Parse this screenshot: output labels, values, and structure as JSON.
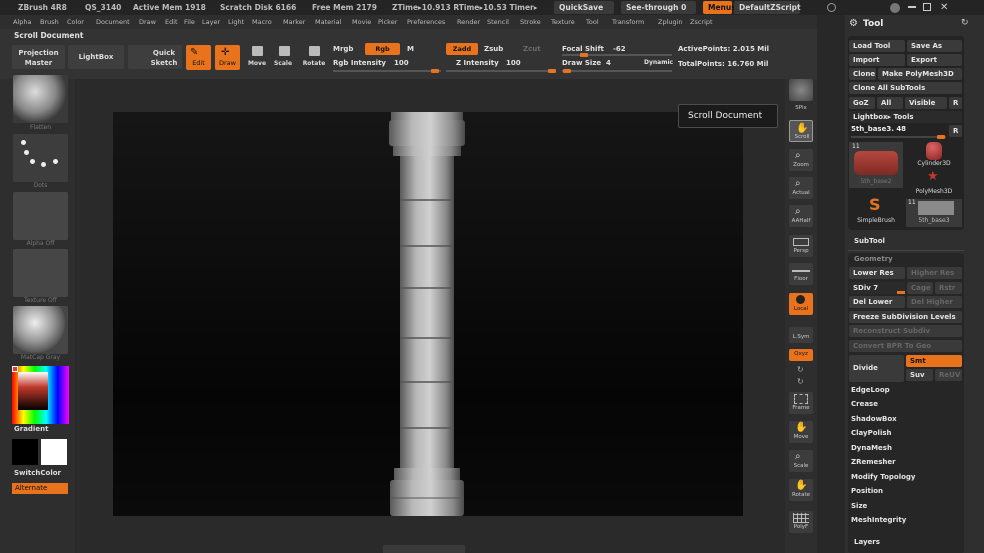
{
  "titlebar": {
    "app": "ZBrush 4R8",
    "qs": "QS_3140",
    "active_mem": "Active Mem 1918",
    "scratch": "Scratch Disk 6166",
    "free_mem": "Free Mem 2179",
    "ztime": "ZTime▸10.913 RTime▸10.53 Timer▸",
    "quicksave": "QuickSave",
    "seethrough": "See-through  0",
    "menus": "Menus",
    "default_script": "DefaultZScript"
  },
  "menubar": [
    "Alpha",
    "Brush",
    "Color",
    "Document",
    "Draw",
    "Edit",
    "File",
    "Layer",
    "Light",
    "Macro",
    "Marker",
    "Material",
    "Movie",
    "Picker",
    "Preferences",
    "Render",
    "Stencil",
    "Stroke",
    "Texture",
    "Tool",
    "Transform",
    "Zplugin",
    "Zscript"
  ],
  "toolbar": {
    "scroll_doc": "Scroll Document",
    "projection_master": "Projection Master",
    "lightbox": "LightBox",
    "quick_sketch": "Quick Sketch",
    "edit": "Edit",
    "draw": "Draw",
    "move": "Move",
    "scale": "Scale",
    "rotate": "Rotate",
    "mrgb": "Mrgb",
    "rgb": "Rgb",
    "m": "M",
    "zadd": "Zadd",
    "zsub": "Zsub",
    "zcut": "Zcut",
    "rgb_intensity_label": "Rgb Intensity",
    "rgb_intensity": "100",
    "z_intensity_label": "Z Intensity",
    "z_intensity": "100",
    "focal_shift_label": "Focal Shift",
    "focal_shift": "-62",
    "draw_size_label": "Draw Size",
    "draw_size": "4",
    "dynamic": "Dynamic",
    "active_points": "ActivePoints: 2.015 Mil",
    "total_points": "TotalPoints: 16.760 Mil"
  },
  "leftshelf": {
    "flatten": "Flatten",
    "dots": "Dots",
    "alpha_off": "Alpha Off",
    "texture_off": "Texture Off",
    "matcap": "MatCap Gray",
    "gradient": "Gradient",
    "switchcolor": "SwitchColor",
    "alternate": "Alternate"
  },
  "rightshelf": [
    "SPix",
    "Scroll",
    "Zoom",
    "Actual",
    "AAHalf",
    "Persp",
    "Floor",
    "Local",
    "L.Sym",
    "Qxyz",
    "Frame",
    "Move",
    "Scale",
    "Rotate",
    "PolyF"
  ],
  "tooltip": "Scroll Document",
  "toolpanel": {
    "title": "Tool",
    "load_tool": "Load Tool",
    "save_as": "Save As",
    "import": "Import",
    "export": "Export",
    "clone": "Clone",
    "make_polymesh": "Make PolyMesh3D",
    "clone_all": "Clone All SubTools",
    "goz": "GoZ",
    "all": "All",
    "visible": "Visible",
    "r": "R",
    "lightbox_tools": "Lightbox▸ Tools",
    "current_tool": "5th_base3. 48",
    "count1": "11",
    "count2": "11",
    "thumbs": [
      "5th_base2",
      "Cylinder3D",
      "PolyMesh3D",
      "SimpleBrush",
      "5th_base3"
    ],
    "subtool": "SubTool",
    "geometry": "Geometry",
    "lower_res": "Lower Res",
    "higher_res": "Higher Res",
    "sdiv": "SDiv 7",
    "cage": "Cage",
    "rstr": "Rstr",
    "del_lower": "Del Lower",
    "del_higher": "Del Higher",
    "freeze": "Freeze SubDivision Levels",
    "reconstruct": "Reconstruct Subdiv",
    "convert_bpr": "Convert BPR To Geo",
    "divide": "Divide",
    "smt": "Smt",
    "suv": "Suv",
    "reuv": "ReUV",
    "items": [
      "EdgeLoop",
      "Crease",
      "ShadowBox",
      "ClayPolish",
      "DynaMesh",
      "ZRemesher",
      "Modify Topology",
      "Position",
      "Size",
      "MeshIntegrity"
    ],
    "layers": "Layers"
  },
  "colors": {
    "accent": "#e8731c"
  }
}
